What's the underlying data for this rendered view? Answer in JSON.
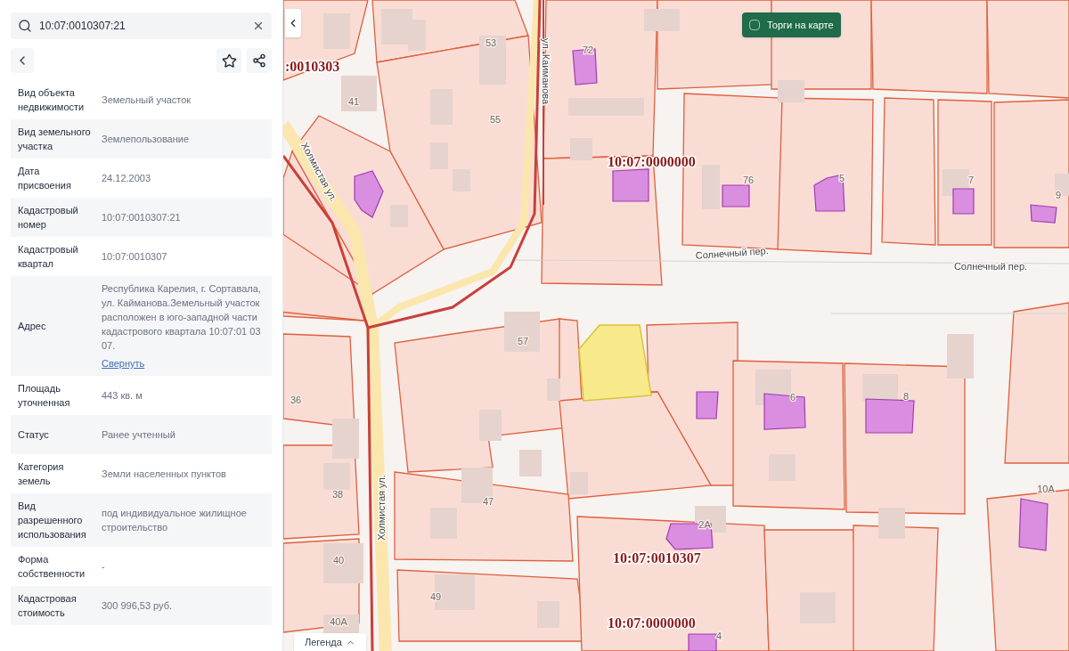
{
  "search": {
    "value": "10:07:0010307:21"
  },
  "details": [
    {
      "label": "Вид объекта недвижимости",
      "value": "Земельный участок"
    },
    {
      "label": "Вид земельного участка",
      "value": "Землепользование"
    },
    {
      "label": "Дата присвоения",
      "value": "24.12.2003"
    },
    {
      "label": "Кадастровый номер",
      "value": "10:07:0010307:21"
    },
    {
      "label": "Кадастровый квартал",
      "value": "10:07:0010307"
    },
    {
      "label": "Адрес",
      "value": "Республика Карелия, г. Сортавала, ул. Кайманова.Земельный участок расположен в юго-западной части кадастрового квартала 10:07:01 03 07.",
      "link": "Свернуть"
    },
    {
      "label": "Площадь уточненная",
      "value": "443 кв. м"
    },
    {
      "label": "Статус",
      "value": "Ранее учтенный"
    },
    {
      "label": "Категория земель",
      "value": "Земли населенных пунктов"
    },
    {
      "label": "Вид разрешенного использования",
      "value": "под индивидуальное жилищное строительство"
    },
    {
      "label": "Форма собственности",
      "value": "-"
    },
    {
      "label": "Кадастровая стоимость",
      "value": "300 996,53 руб."
    }
  ],
  "map": {
    "auction_toggle": {
      "label": "Торги на карте",
      "checked": false
    },
    "legend": {
      "label": "Легенда",
      "expanded": false
    },
    "house_numbers": [
      "53",
      "41",
      "55",
      "72",
      "76",
      "5",
      "7",
      "9",
      "57",
      "36",
      "6",
      "8",
      "38",
      "47",
      "40",
      "49",
      "40А",
      "2А",
      "10А",
      "4"
    ],
    "streets": [
      "ул. Каиманова",
      "Холмистая ул.",
      "Холмистая ул.",
      "Солнечный пер.",
      "Солнечный пер."
    ],
    "quarter_labels": [
      ":0010303",
      "10:07:0000000",
      "10:07:0010307",
      "10:07:0000000"
    ]
  }
}
